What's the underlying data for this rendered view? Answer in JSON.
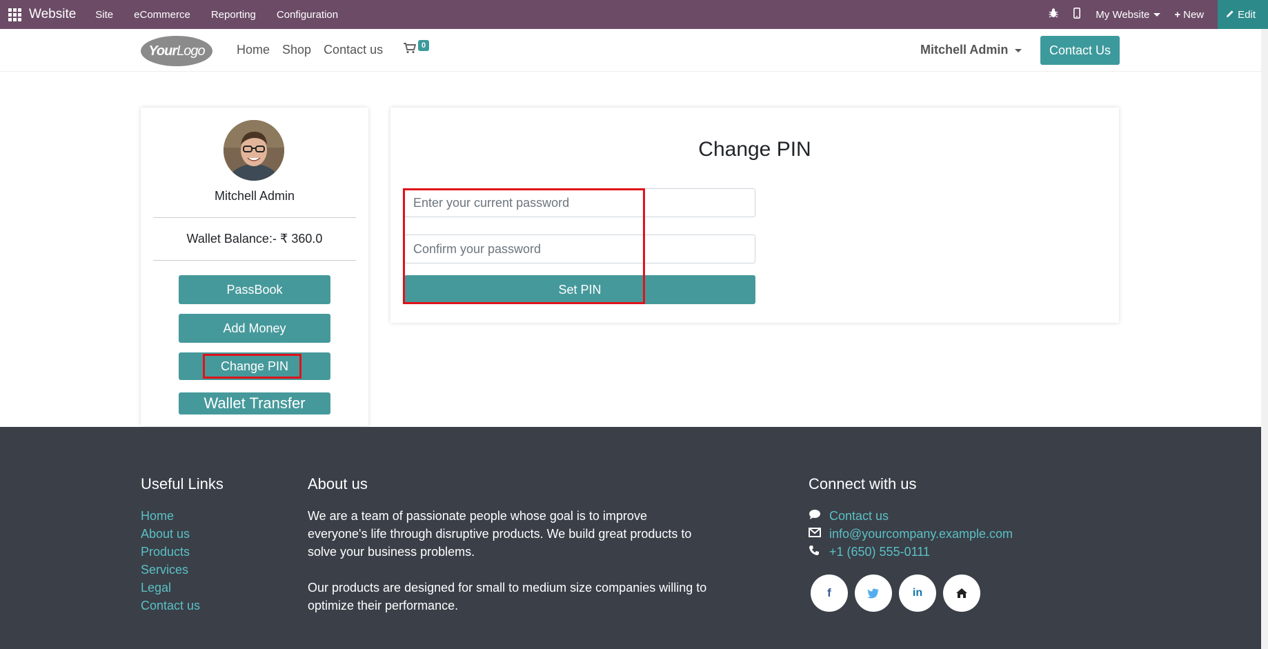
{
  "topbar": {
    "brand": "Website",
    "menu": [
      "Site",
      "eCommerce",
      "Reporting",
      "Configuration"
    ],
    "site_selector": "My Website",
    "new_label": "New",
    "edit_label": "Edit"
  },
  "header": {
    "logo_text_bold": "Your",
    "logo_text": "Logo",
    "nav": [
      "Home",
      "Shop",
      "Contact us"
    ],
    "cart_count": "0",
    "user_name": "Mitchell Admin",
    "contact_button": "Contact Us"
  },
  "sidebar": {
    "user_name": "Mitchell Admin",
    "wallet_balance": "Wallet Balance:- ₹ 360.0",
    "buttons": [
      "PassBook",
      "Add Money",
      "Change PIN",
      "Wallet Transfer"
    ]
  },
  "form": {
    "title": "Change PIN",
    "current_password_placeholder": "Enter your current password",
    "confirm_password_placeholder": "Confirm your password",
    "submit_label": "Set PIN"
  },
  "footer": {
    "useful_links_title": "Useful Links",
    "useful_links": [
      "Home",
      "About us",
      "Products",
      "Services",
      "Legal",
      "Contact us"
    ],
    "about_title": "About us",
    "about_p1": "We are a team of passionate people whose goal is to improve everyone's life through disruptive products. We build great products to solve your business problems.",
    "about_p2": "Our products are designed for small to medium size companies willing to optimize their performance.",
    "connect_title": "Connect with us",
    "connect_contact": "Contact us",
    "connect_email": "info@yourcompany.example.com",
    "connect_phone": "+1 (650) 555-0111",
    "social_icons": [
      "facebook-icon",
      "twitter-icon",
      "linkedin-icon",
      "home-icon"
    ]
  },
  "colors": {
    "topbar": "#6b4b66",
    "accent": "#46999b",
    "footer_bg": "#3a3f48",
    "footer_link": "#5bc0c4",
    "highlight": "#e0121a"
  }
}
